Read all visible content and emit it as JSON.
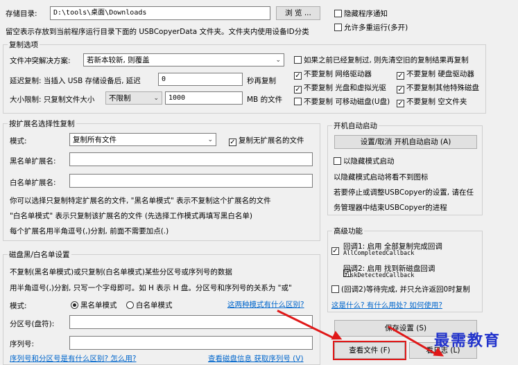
{
  "storage": {
    "label": "存储目录:",
    "path": "D:\\tools\\桌面\\Downloads",
    "browse_label": "浏 览 ...",
    "hide_notify_label": "隐藏程序通知",
    "allow_multi_label": "允许多重运行(多开)",
    "note": "留空表示存放到当前程序运行目录下面的 USBCopyerData 文件夹。文件夹内使用设备ID分类"
  },
  "copy_options": {
    "title": "复制选项",
    "conflict_label": "文件冲突解决方案:",
    "conflict_value": "若新本较新, 则覆盖",
    "delay_label": "延迟复制: 当插入 USB 存储设备后, 延迟",
    "delay_value": "0",
    "delay_unit": "秒再复制",
    "size_label": "大小限制: 只复制文件大小",
    "size_select": "不限制",
    "size_value": "1000",
    "size_unit": "MB 的文件",
    "chk_resume": "如果之前已经复制过, 则先清空旧的复制结果再复制",
    "chk_network": "不要复制 网络驱动器",
    "chk_hdd": "不要复制 硬盘驱动器",
    "chk_optical": "不要复制 光盘和虚拟光驱",
    "chk_other": "不要复制其他特殊磁盘",
    "chk_removable": "不要复制 可移动磁盘(U盘)",
    "chk_empty": "不要复制 空文件夹"
  },
  "ext_filter": {
    "title": "按扩展名选择性复制",
    "mode_label": "模式:",
    "mode_value": "复制所有文件",
    "no_ext_label": "复制无扩展名的文件",
    "blacklist_label": "黑名单扩展名:",
    "whitelist_label": "白名单扩展名:",
    "desc1": "你可以选择只复制特定扩展名的文件, \"黑名单模式\" 表示不复制这个扩展名的文件",
    "desc2": "\"白名单模式\" 表示只复制该扩展名的文件   (先选择工作模式再填写黑白名单)",
    "desc3": "每个扩展名用半角逗号(,)分割, 前面不需要加点(.)"
  },
  "disk_filter": {
    "title": "磁盘黑/白名单设置",
    "desc1": "不复制(黑名单模式)或只复制(白名单模式)某些分区号或序列号的数据",
    "desc2": "用半角逗号(,)分割, 只写一个字母即可。如 H 表示 H 盘。分区号和序列号的关系为 \"或\"",
    "mode_label": "模式:",
    "black_mode": "黑名单模式",
    "white_mode": "白名单模式",
    "diff_link": "这两种模式有什么区别?",
    "partition_label": "分区号(盘符):",
    "serial_label": "序列号:",
    "bottom_link1": "序列号和分区号是有什么区别? 怎么用?",
    "bottom_link2": "查看磁盘信息 获取序列号 (V)"
  },
  "startup": {
    "title": "开机自动启动",
    "button": "设置/取消 开机自动启动 (A)",
    "hidden_label": "以隐藏模式启动",
    "desc1": "以隐藏模式启动将看不到图标",
    "desc2": "若要停止或调整USBCopyer的设置, 请在任",
    "desc3": "务管理器中结束USBCopyer的进程"
  },
  "advanced": {
    "title": "高级功能",
    "cb1_line1": "回调1: 启用 全部复制完成回调",
    "cb1_line2": "AllCompletedCallback",
    "cb2_line1": "回调2: 启用 找到新磁盘回调",
    "cb2_line2": "DiskDetectedCallback",
    "cb3": "(回调2)等待完成, 并只允许返回0时复制",
    "link": "这是什么? 有什么用处? 如何使用?"
  },
  "buttons": {
    "save": "保存设置 (S)",
    "view_files": "查看文件 (F)",
    "view_log": "看日志 (L)"
  },
  "watermark": "最需教育",
  "colors": {
    "accent": "#e01818",
    "link": "#0066cc",
    "watermark": "#2233cc"
  }
}
